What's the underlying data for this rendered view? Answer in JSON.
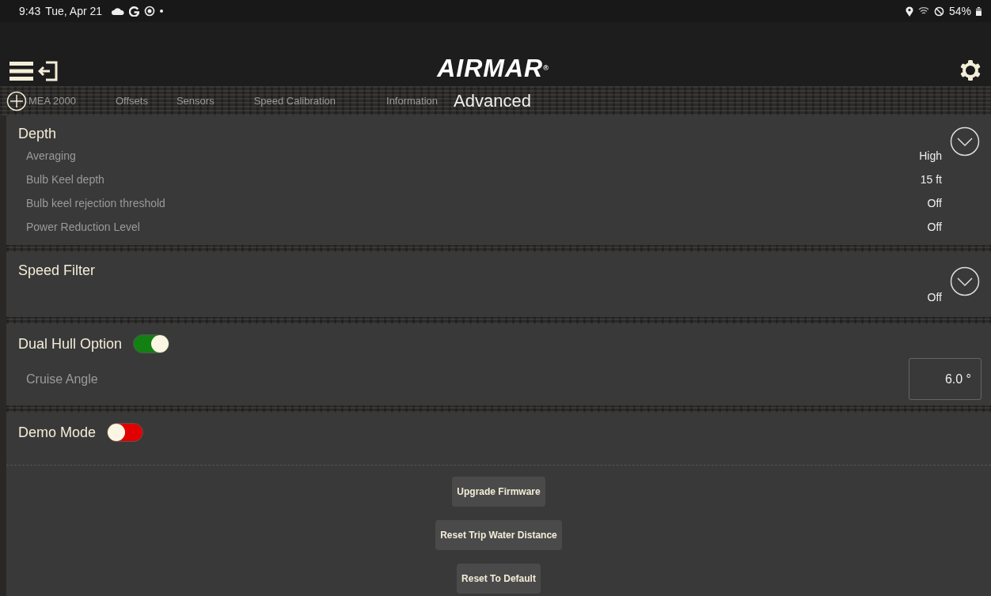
{
  "status_bar": {
    "time": "9:43",
    "date": "Tue, Apr 21",
    "battery": "54%"
  },
  "header": {
    "logo": "AIRMAR",
    "logo_mark": "®"
  },
  "tabs": [
    {
      "label": "MEA 2000",
      "selected": false
    },
    {
      "label": "Offsets",
      "selected": false
    },
    {
      "label": "Sensors",
      "selected": false
    },
    {
      "label": "Speed Calibration",
      "selected": false
    },
    {
      "label": "Information",
      "selected": false
    },
    {
      "label": "Advanced",
      "selected": true
    }
  ],
  "sections": [
    {
      "kind": "expandable",
      "title": "Depth",
      "expanded": false,
      "rows": [
        {
          "label": "Averaging",
          "value": "High"
        },
        {
          "label": "Bulb Keel depth",
          "value": "15 ft"
        },
        {
          "label": "Bulb keel rejection threshold",
          "value": "Off"
        },
        {
          "label": "Power Reduction Level",
          "value": "Off"
        }
      ]
    },
    {
      "kind": "expandable",
      "title": "Speed Filter",
      "expanded": false,
      "value": "Off"
    },
    {
      "kind": "toggle",
      "title": "Dual Hull Option",
      "on": true,
      "field": {
        "label": "Cruise Angle",
        "value": "6.0 °"
      }
    },
    {
      "kind": "toggle",
      "title": "Demo Mode",
      "on": false
    }
  ],
  "buttons": [
    "Upgrade Firmware",
    "Reset Trip Water Distance",
    "Reset To Default"
  ]
}
